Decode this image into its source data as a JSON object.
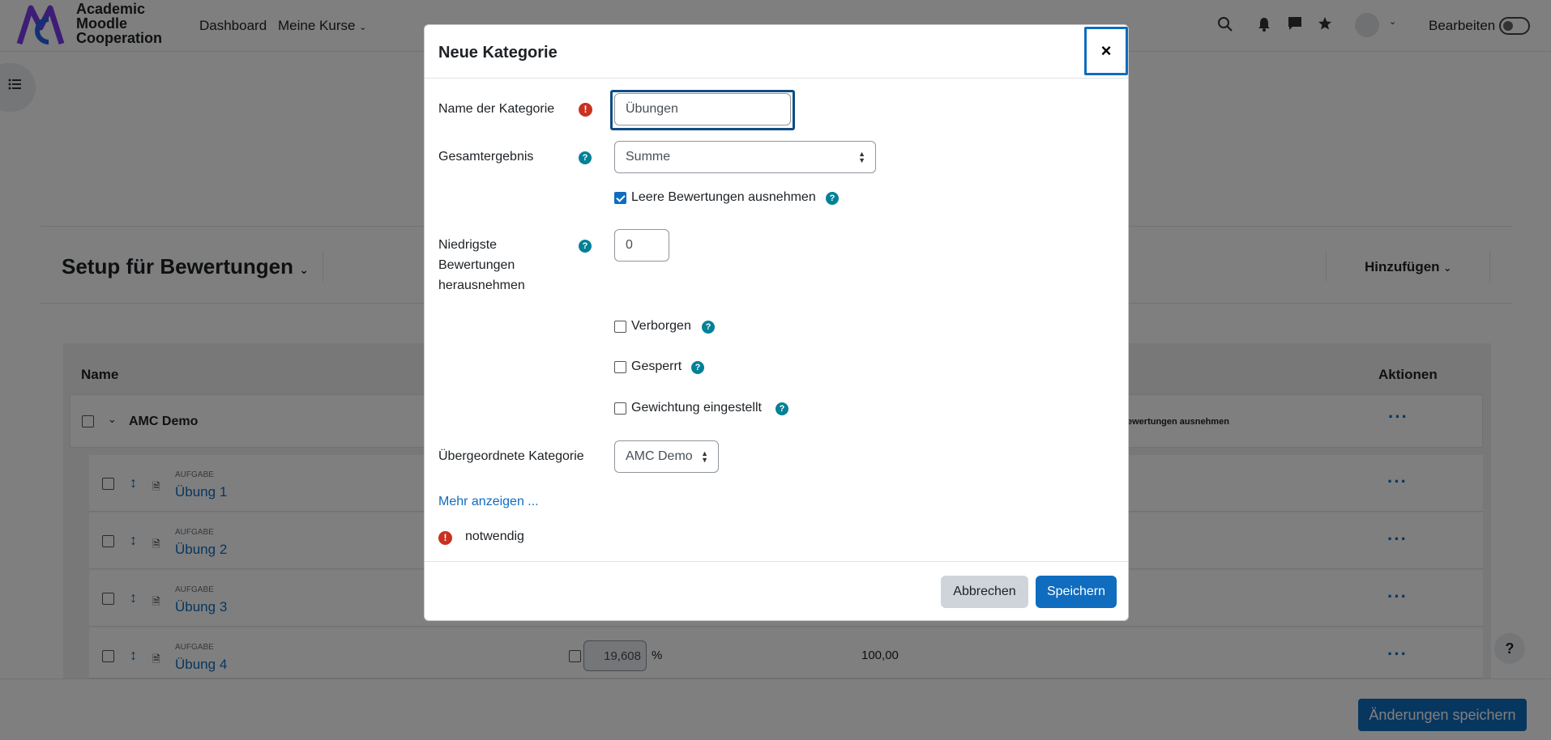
{
  "navbar": {
    "logo_lines": [
      "Academic",
      "Moodle",
      "Cooperation"
    ],
    "dashboard": "Dashboard",
    "my_courses": "Meine Kurse",
    "edit_mode": "Bearbeiten"
  },
  "page": {
    "setup_title": "Setup für Bewertungen",
    "add_button": "Hinzufügen",
    "table_headers": {
      "name": "Name",
      "actions": "Aktionen"
    },
    "category": {
      "name": "AMC Demo",
      "info_snippet": "ewertungen ausnehmen"
    },
    "items": [
      {
        "type": "AUFGABE",
        "name": "Übung 1"
      },
      {
        "type": "AUFGABE",
        "name": "Übung 2"
      },
      {
        "type": "AUFGABE",
        "name": "Übung 3"
      },
      {
        "type": "AUFGABE",
        "name": "Übung 4",
        "weight": "19,608",
        "percent": "%",
        "max": "100,00"
      }
    ],
    "save_changes": "Änderungen speichern",
    "help": "?"
  },
  "modal": {
    "title": "Neue Kategorie",
    "close": "×",
    "category_name_label": "Name der Kategorie",
    "category_name_value": "Übungen",
    "aggregation_label": "Gesamtergebnis",
    "aggregation_value": "Summe",
    "exclude_empty_label": "Leere Bewertungen ausnehmen",
    "exclude_empty_checked": true,
    "drop_lowest_label_lines": [
      "Niedrigste",
      "Bewertungen",
      "herausnehmen"
    ],
    "drop_lowest_value": "0",
    "hidden_label": "Verborgen",
    "locked_label": "Gesperrt",
    "weight_label": "Gewichtung eingestellt",
    "parent_label": "Übergeordnete Kategorie",
    "parent_value": "AMC Demo",
    "show_more": "Mehr anzeigen ...",
    "required_label": "notwendig",
    "cancel": "Abbrechen",
    "save": "Speichern"
  },
  "colors": {
    "primary": "#0f6cbf",
    "info": "#008196",
    "required": "#ca3120"
  }
}
